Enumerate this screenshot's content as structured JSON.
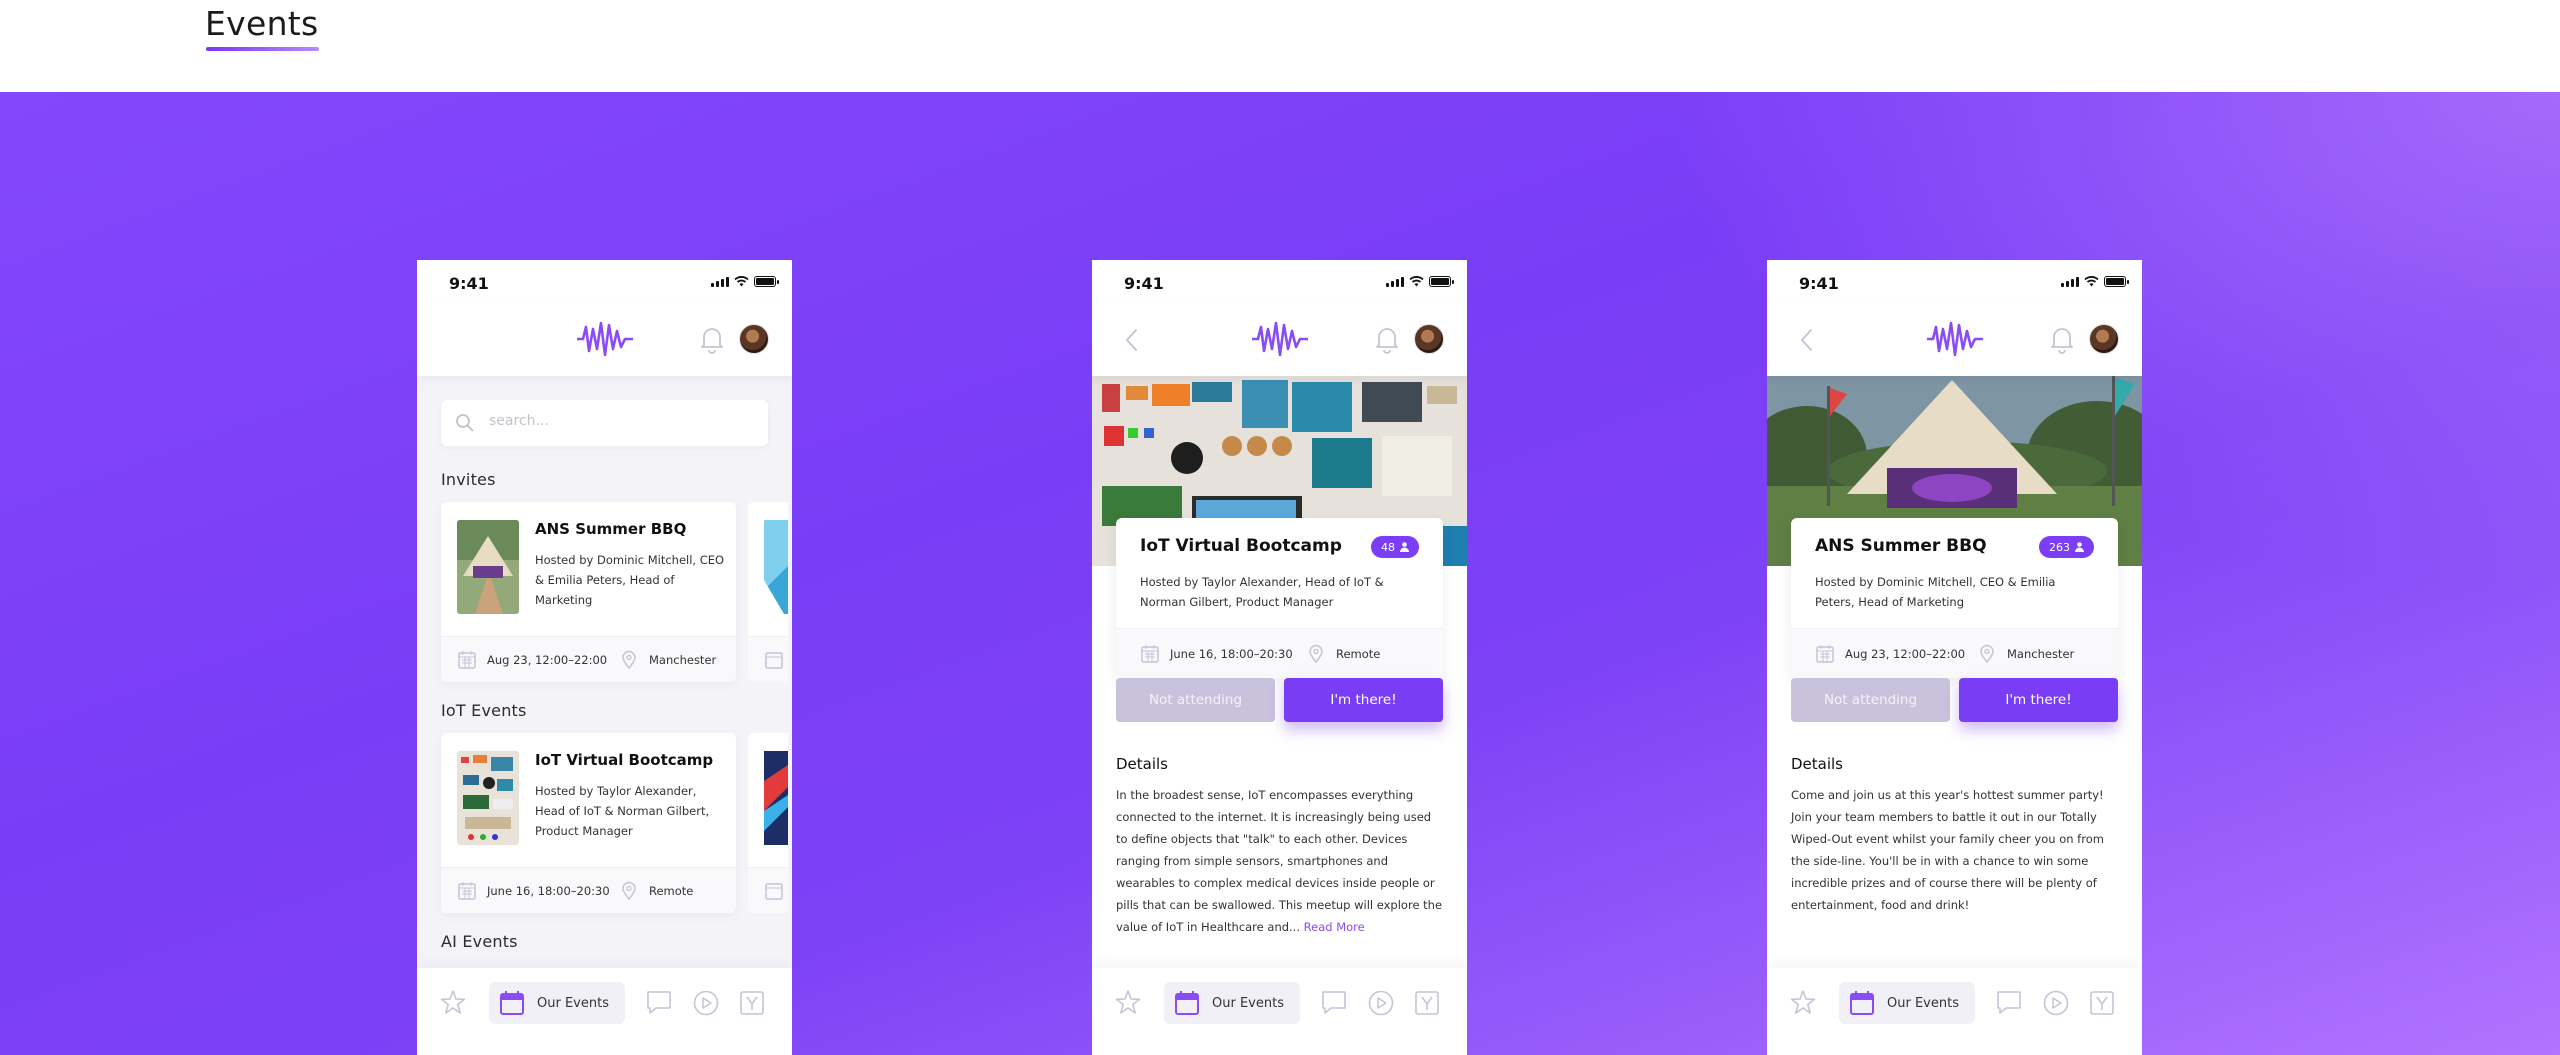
{
  "page": {
    "title": "Events"
  },
  "status": {
    "time": "9:41"
  },
  "list_screen": {
    "search_placeholder": "search...",
    "sections": [
      "Invites",
      "IoT Events",
      "AI Events"
    ],
    "cards": [
      {
        "title": "ANS Summer BBQ",
        "host": "Hosted by Dominic Mitchell, CEO & Emilia Peters, Head of Marketing",
        "date": "Aug 23, 12:00–22:00",
        "location": "Manchester"
      },
      {
        "title": "IoT Virtual Bootcamp",
        "host": "Hosted by Taylor Alexander, Head of IoT & Norman Gilbert, Product Manager",
        "date": "June 16, 18:00–20:30",
        "location": "Remote"
      }
    ]
  },
  "iot_detail": {
    "title": "IoT Virtual Bootcamp",
    "attendees": "48",
    "host": "Hosted by Taylor Alexander, Head of IoT & Norman Gilbert, Product Manager",
    "date": "June 16, 18:00–20:30",
    "location": "Remote",
    "details_heading": "Details",
    "details_body": "In the broadest sense, IoT encompasses everything connected to the internet. It is increasingly being used to define objects that \"talk\" to each other. Devices ranging from simple sensors, smartphones and wearables to complex medical devices inside people or pills that can be swallowed. This meetup will explore the value of IoT in Healthcare and...",
    "read_more": "Read More"
  },
  "bbq_detail": {
    "title": "ANS Summer BBQ",
    "attendees": "263",
    "host": "Hosted by Dominic Mitchell, CEO & Emilia Peters, Head of Marketing",
    "date": "Aug 23, 12:00–22:00",
    "location": "Manchester",
    "details_heading": "Details",
    "details_body": "Come and join us at this year's hottest summer party! Join your team members to battle it out in our Totally Wiped-Out event whilst your family cheer you on from the side-line. You'll be in with a chance to win some incredible prizes and of course there will be plenty of entertainment, food and drink!"
  },
  "buttons": {
    "not_attending": "Not attending",
    "attending": "I'm there!"
  },
  "tabbar": {
    "active_label": "Our Events"
  },
  "colors": {
    "accent": "#7a3df6",
    "background": "#8447fb"
  }
}
